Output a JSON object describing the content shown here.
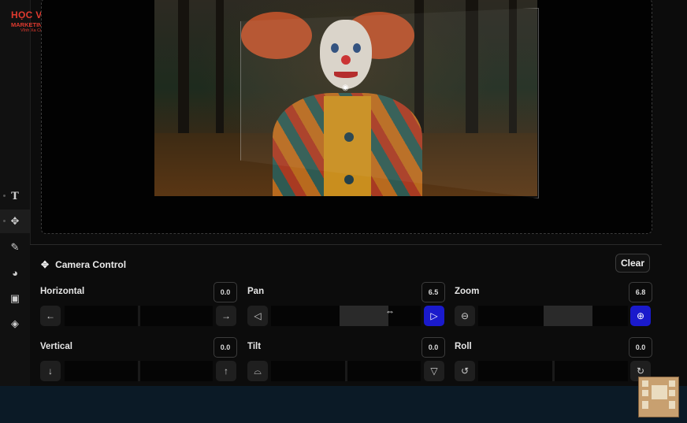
{
  "logo": {
    "line1": "HỌC VIỆN",
    "line2": "MARKETING ONLINE",
    "line3": "Vĩnh Xa Cùng Bạn"
  },
  "panel": {
    "title": "Camera Control",
    "clear_label": "Clear"
  },
  "controls": {
    "horizontal": {
      "label": "Horizontal",
      "value": "0.0"
    },
    "pan": {
      "label": "Pan",
      "value": "6.5"
    },
    "zoom": {
      "label": "Zoom",
      "value": "6.8"
    },
    "vertical": {
      "label": "Vertical",
      "value": "0.0"
    },
    "tilt": {
      "label": "Tilt",
      "value": "0.0"
    },
    "roll": {
      "label": "Roll",
      "value": "0.0"
    }
  },
  "sliders": {
    "pan_level": 0.62,
    "zoom_level": 0.6
  },
  "colors": {
    "accent": "#1a1acc",
    "background": "#0c0c0c",
    "footer": "#0b1a26"
  }
}
